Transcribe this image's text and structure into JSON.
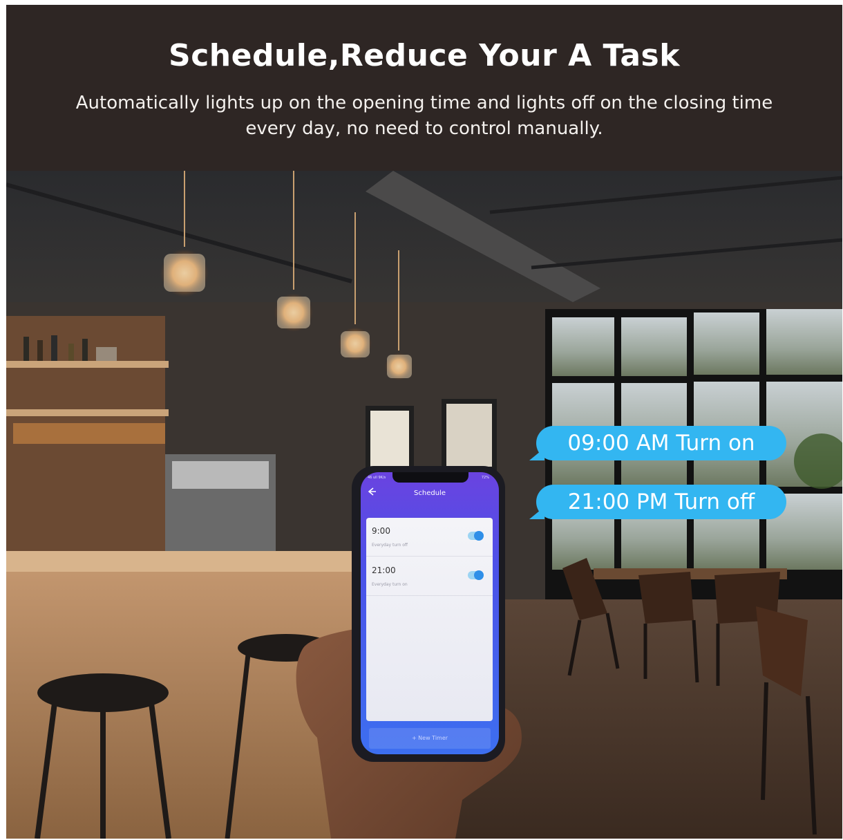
{
  "banner": {
    "headline": "Schedule,Reduce Your A Task",
    "subline": "Automatically lights up on the opening time and lights off on the closing time every day, no need to control manually."
  },
  "bubbles": [
    {
      "label": "09:00 AM Turn on"
    },
    {
      "label": "21:00 PM Turn off"
    }
  ],
  "phone": {
    "status_left": "46 ull 9K/s",
    "status_right": "72%",
    "screen_title": "Schedule",
    "timers": [
      {
        "time": "9:00",
        "subtitle": "Everyday turn off",
        "enabled": true
      },
      {
        "time": "21:00",
        "subtitle": "Everyday turn on",
        "enabled": true
      }
    ],
    "new_timer_label": "+ New Timer"
  },
  "colors": {
    "banner_bg": "#2e2624",
    "bubble": "#33b6f1",
    "app_gradient_top": "#6a43e0",
    "app_gradient_bottom": "#3d6ff0"
  }
}
